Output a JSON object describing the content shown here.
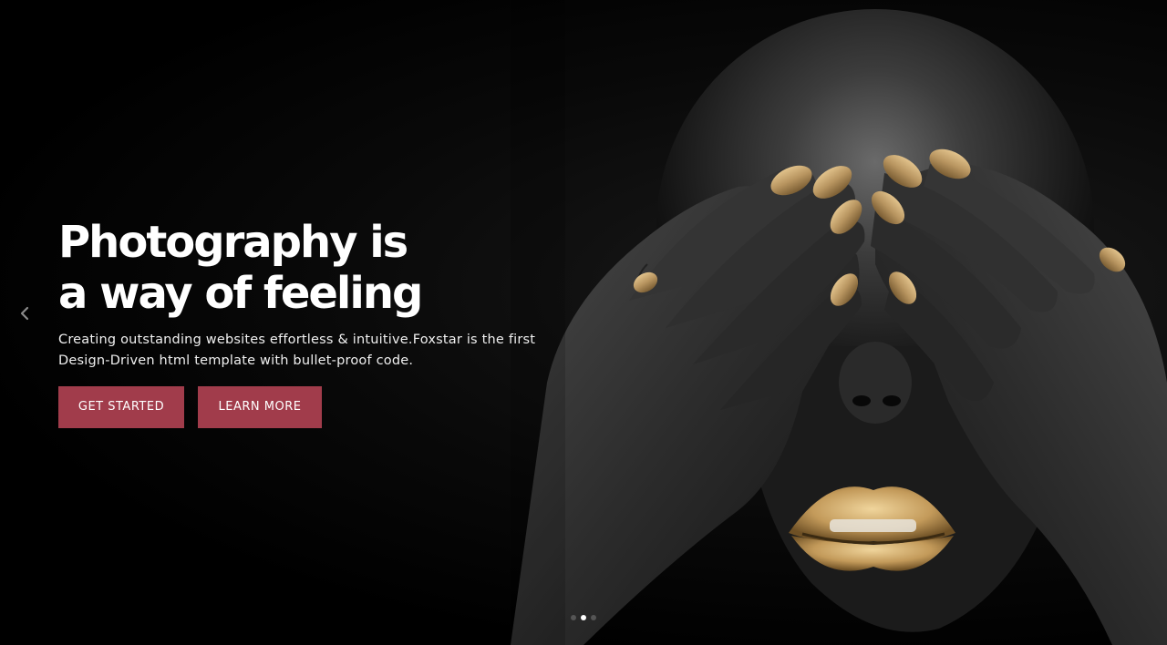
{
  "hero": {
    "headline_line1": "Photography is",
    "headline_line2": "a way of feeling",
    "subtitle": "Creating outstanding websites effortless & intuitive.Foxstar is the first Design-Driven html template with bullet-proof code.",
    "primary_button": "GET STARTED",
    "secondary_button": "LEARN MORE"
  },
  "slider": {
    "prev_icon": "chevron-left-icon",
    "dots": 3,
    "active_dot": 2
  },
  "colors": {
    "accent": "#a13c4b",
    "background": "#000000",
    "text": "#ffffff",
    "gold": "#c9a66b"
  }
}
